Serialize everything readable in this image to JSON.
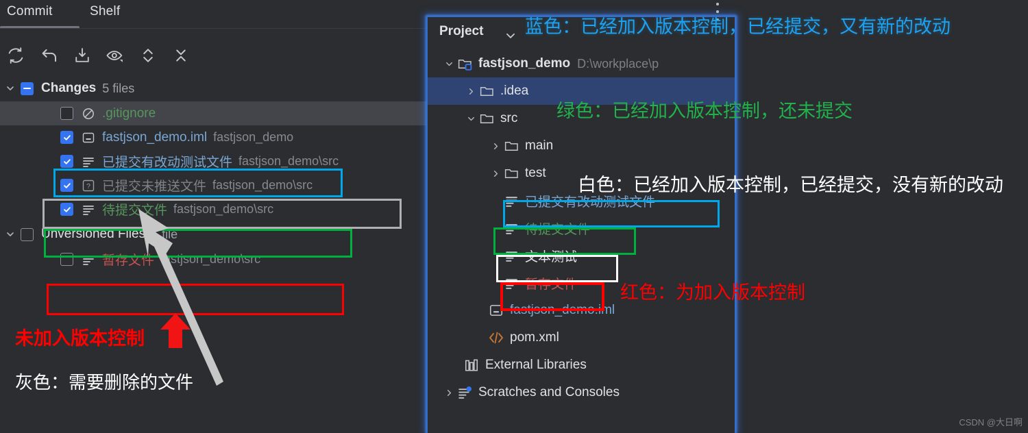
{
  "commit_panel": {
    "tabs": [
      {
        "label": "Commit",
        "active": true
      },
      {
        "label": "Shelf",
        "active": false
      }
    ],
    "toolbar": [
      {
        "icon": "refresh-icon",
        "title": "Refresh"
      },
      {
        "icon": "revert-icon",
        "title": "Rollback"
      },
      {
        "icon": "shelve-icon",
        "title": "Shelve"
      },
      {
        "icon": "preview-diff-icon",
        "title": "Show Diff Preview"
      },
      {
        "icon": "expand-collapse-icon",
        "title": "Expand or Collapse"
      },
      {
        "icon": "collapse-all-icon",
        "title": "Collapse All"
      }
    ],
    "groups": [
      {
        "name": "Changes",
        "count_label": "5 files",
        "checkbox": "partial",
        "expanded": true,
        "files": [
          {
            "checkbox": "empty",
            "icon": "ignored-file-icon",
            "name": ".gitignore",
            "path": "",
            "color": "green",
            "selected": true
          },
          {
            "checkbox": "checked",
            "icon": "iml-file-icon",
            "name": "fastjson_demo.iml",
            "path": "fastjson_demo",
            "color": "blue",
            "selected": false
          },
          {
            "checkbox": "checked",
            "icon": "text-file-icon",
            "name": "已提交有改动测试文件",
            "path": "fastjson_demo\\src",
            "color": "blue",
            "selected": false
          },
          {
            "checkbox": "checked",
            "icon": "unknown-file-icon",
            "name": "已提交未推送文件",
            "path": "fastjson_demo\\src",
            "color": "gray",
            "selected": false
          },
          {
            "checkbox": "checked",
            "icon": "text-file-icon",
            "name": "待提交文件",
            "path": "fastjson_demo\\src",
            "color": "green",
            "selected": false
          }
        ]
      },
      {
        "name": "Unversioned Files",
        "count_label": "1 file",
        "checkbox": "empty",
        "expanded": true,
        "files": [
          {
            "checkbox": "empty",
            "icon": "text-file-icon",
            "name": "暂存文件",
            "path": "fastjson_demo\\src",
            "color": "red",
            "selected": false
          }
        ]
      }
    ]
  },
  "project_panel": {
    "title": "Project",
    "title_chevron": "chevron-down-icon",
    "kebab": "more-options-icon",
    "tree": [
      {
        "depth": 0,
        "twisty": "chevron-down-icon",
        "icon": "module-folder-icon",
        "label": "fastjson_demo",
        "path": "D:\\workplace\\p",
        "color": "white",
        "bold": true,
        "selected": false
      },
      {
        "depth": 1,
        "twisty": "chevron-right-icon",
        "icon": "folder-icon",
        "label": ".idea",
        "path": "",
        "color": "white",
        "bold": false,
        "selected": true
      },
      {
        "depth": 1,
        "twisty": "chevron-down-icon",
        "icon": "folder-icon",
        "label": "src",
        "path": "",
        "color": "white",
        "bold": false,
        "selected": false
      },
      {
        "depth": 2,
        "twisty": "chevron-right-icon",
        "icon": "folder-icon",
        "label": "main",
        "path": "",
        "color": "white",
        "bold": false,
        "selected": false
      },
      {
        "depth": 2,
        "twisty": "chevron-right-icon",
        "icon": "folder-icon",
        "label": "test",
        "path": "",
        "color": "white",
        "bold": false,
        "selected": false
      },
      {
        "depth": 3,
        "twisty": "none",
        "icon": "text-file-icon",
        "label": "已提交有改动测试文件",
        "path": "",
        "color": "blue",
        "bold": false,
        "selected": false
      },
      {
        "depth": 3,
        "twisty": "none",
        "icon": "text-file-icon",
        "label": "待提交文件",
        "path": "",
        "color": "green",
        "bold": false,
        "selected": false
      },
      {
        "depth": 3,
        "twisty": "none",
        "icon": "text-file-icon",
        "label": "文本测试",
        "path": "",
        "color": "white",
        "bold": false,
        "selected": false
      },
      {
        "depth": 3,
        "twisty": "none",
        "icon": "text-file-icon",
        "label": "暂存文件",
        "path": "",
        "color": "red",
        "bold": false,
        "selected": false
      },
      {
        "depth": 2,
        "twisty": "none",
        "icon": "iml-file-icon",
        "label": "fastjson_demo.iml",
        "path": "",
        "color": "blue",
        "bold": false,
        "selected": false
      },
      {
        "depth": 2,
        "twisty": "none",
        "icon": "xml-file-icon",
        "label": "pom.xml",
        "path": "",
        "color": "white",
        "bold": false,
        "selected": false
      },
      {
        "depth": 1,
        "twisty": "none",
        "icon": "libraries-icon",
        "label": "External Libraries",
        "path": "",
        "color": "white",
        "bold": false,
        "selected": false
      },
      {
        "depth": 0,
        "twisty": "chevron-right-icon",
        "icon": "scratches-icon",
        "label": "Scratches and Consoles",
        "path": "",
        "color": "white",
        "bold": false,
        "selected": false
      }
    ]
  },
  "annotations": [
    {
      "id": "blue-note",
      "text": "蓝色：已经加入版本控制，已经提交，又有新的改动",
      "color": "blue"
    },
    {
      "id": "green-note",
      "text": "绿色：已经加入版本控制，还未提交",
      "color": "green"
    },
    {
      "id": "white-note",
      "text": "白色：已经加入版本控制，已经提交，没有新的改动",
      "color": "white"
    },
    {
      "id": "red-note",
      "text": "红色：为加入版本控制",
      "color": "red"
    },
    {
      "id": "unversioned-note",
      "text": "未加入版本控制",
      "color": "red"
    },
    {
      "id": "gray-note",
      "text": "灰色：需要删除的文件",
      "color": "white"
    }
  ],
  "colors": {
    "accent_blue": "#3574f0",
    "highlight_cyan": "#00a8e8",
    "highlight_green": "#00b140",
    "highlight_white": "#ffffff",
    "highlight_gray": "#b0b0b0",
    "highlight_red": "#ff0000",
    "panel_bg": "#2b2d30",
    "selection_bg": "#2f4472"
  },
  "watermark": {
    "text": "CSDN @大日啊"
  }
}
